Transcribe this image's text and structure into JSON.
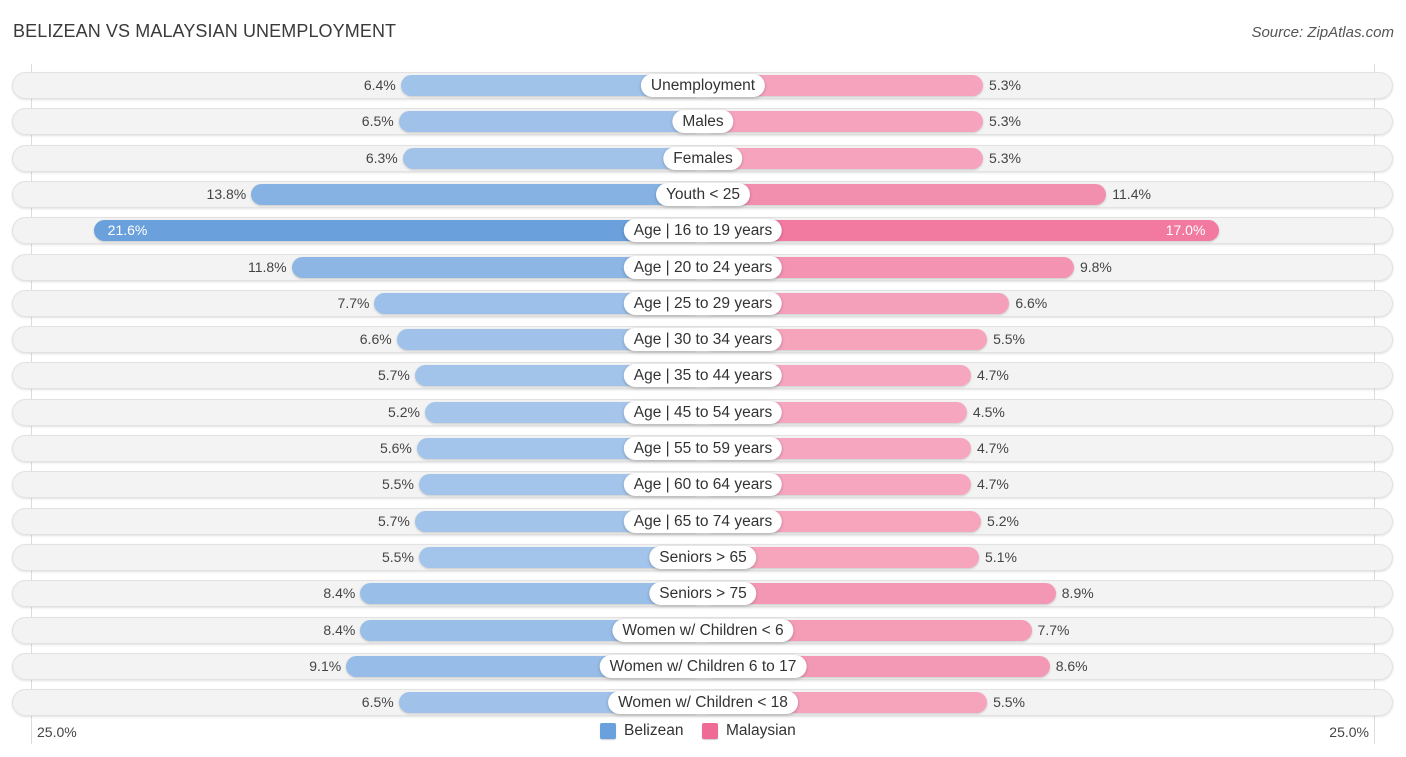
{
  "chart_data": {
    "type": "bar",
    "orientation": "horizontal-diverging",
    "title": "BELIZEAN VS MALAYSIAN UNEMPLOYMENT",
    "source": "Source: ZipAtlas.com",
    "categories": [
      "Unemployment",
      "Males",
      "Females",
      "Youth < 25",
      "Age | 16 to 19 years",
      "Age | 20 to 24 years",
      "Age | 25 to 29 years",
      "Age | 30 to 34 years",
      "Age | 35 to 44 years",
      "Age | 45 to 54 years",
      "Age | 55 to 59 years",
      "Age | 60 to 64 years",
      "Age | 65 to 74 years",
      "Seniors > 65",
      "Seniors > 75",
      "Women w/ Children < 6",
      "Women w/ Children 6 to 17",
      "Women w/ Children < 18"
    ],
    "series": [
      {
        "name": "Belizean",
        "side": "left",
        "color": "#6aa0dc",
        "color_light": "#a9c8ec",
        "values": [
          6.4,
          6.5,
          6.3,
          13.8,
          21.6,
          11.8,
          7.7,
          6.6,
          5.7,
          5.2,
          5.6,
          5.5,
          5.7,
          5.5,
          8.4,
          8.4,
          9.1,
          6.5
        ],
        "labels": [
          "6.4%",
          "6.5%",
          "6.3%",
          "13.8%",
          "21.6%",
          "11.8%",
          "7.7%",
          "6.6%",
          "5.7%",
          "5.2%",
          "5.6%",
          "5.5%",
          "5.7%",
          "5.5%",
          "8.4%",
          "8.4%",
          "9.1%",
          "6.5%"
        ]
      },
      {
        "name": "Malaysian",
        "side": "right",
        "color": "#f06a96",
        "color_light": "#f6a9c0",
        "values": [
          5.3,
          5.3,
          5.3,
          11.4,
          17.0,
          9.8,
          6.6,
          5.5,
          4.7,
          4.5,
          4.7,
          4.7,
          5.2,
          5.1,
          8.9,
          7.7,
          8.6,
          5.5
        ],
        "labels": [
          "5.3%",
          "5.3%",
          "5.3%",
          "11.4%",
          "17.0%",
          "9.8%",
          "6.6%",
          "5.5%",
          "4.7%",
          "4.5%",
          "4.7%",
          "4.7%",
          "5.2%",
          "5.1%",
          "8.9%",
          "7.7%",
          "8.6%",
          "5.5%"
        ]
      }
    ],
    "axis": {
      "min_label": "25.0%",
      "max_label": "25.0%",
      "max": 25.0
    },
    "legend": {
      "position": "bottom-center",
      "entries": [
        "Belizean",
        "Malaysian"
      ]
    },
    "grid": false
  }
}
